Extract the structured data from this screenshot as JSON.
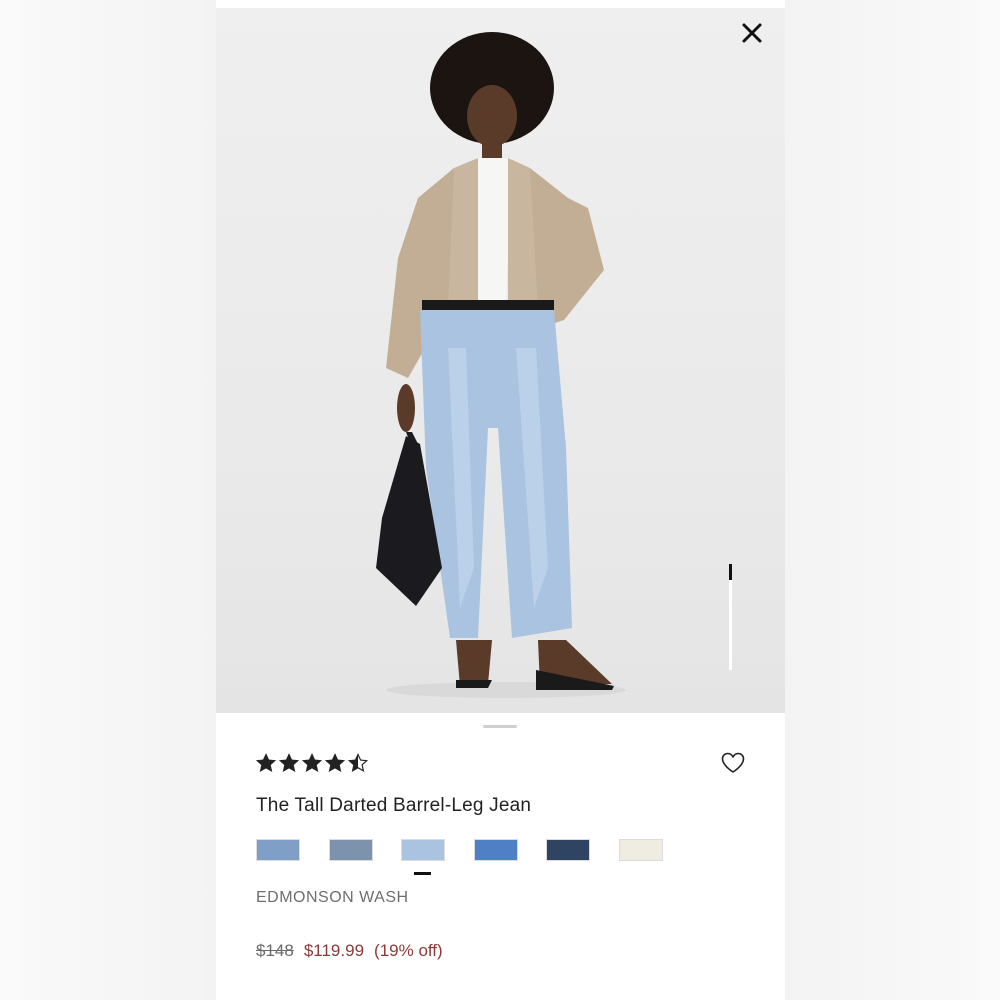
{
  "product": {
    "title": "The Tall Darted Barrel-Leg Jean",
    "rating": 4.5,
    "rating_max": 5,
    "wash_name": "EDMONSON WASH",
    "price_original": "$148",
    "price_sale": "$119.99",
    "discount": "(19% off)",
    "swatches": [
      {
        "color": "#7f9fc7",
        "selected": false
      },
      {
        "color": "#7d93ad",
        "selected": false
      },
      {
        "color": "#a9c3e0",
        "selected": true
      },
      {
        "color": "#4f7fc4",
        "selected": false
      },
      {
        "color": "#2f4463",
        "selected": false
      },
      {
        "color": "#efece1",
        "selected": false
      }
    ]
  },
  "icons": {
    "close": "close-icon",
    "favorite": "heart-icon",
    "rating": "star-icon"
  },
  "colors": {
    "accent_sale": "#8a3a3a",
    "text_primary": "#222222",
    "text_secondary": "#6e6e6e"
  }
}
